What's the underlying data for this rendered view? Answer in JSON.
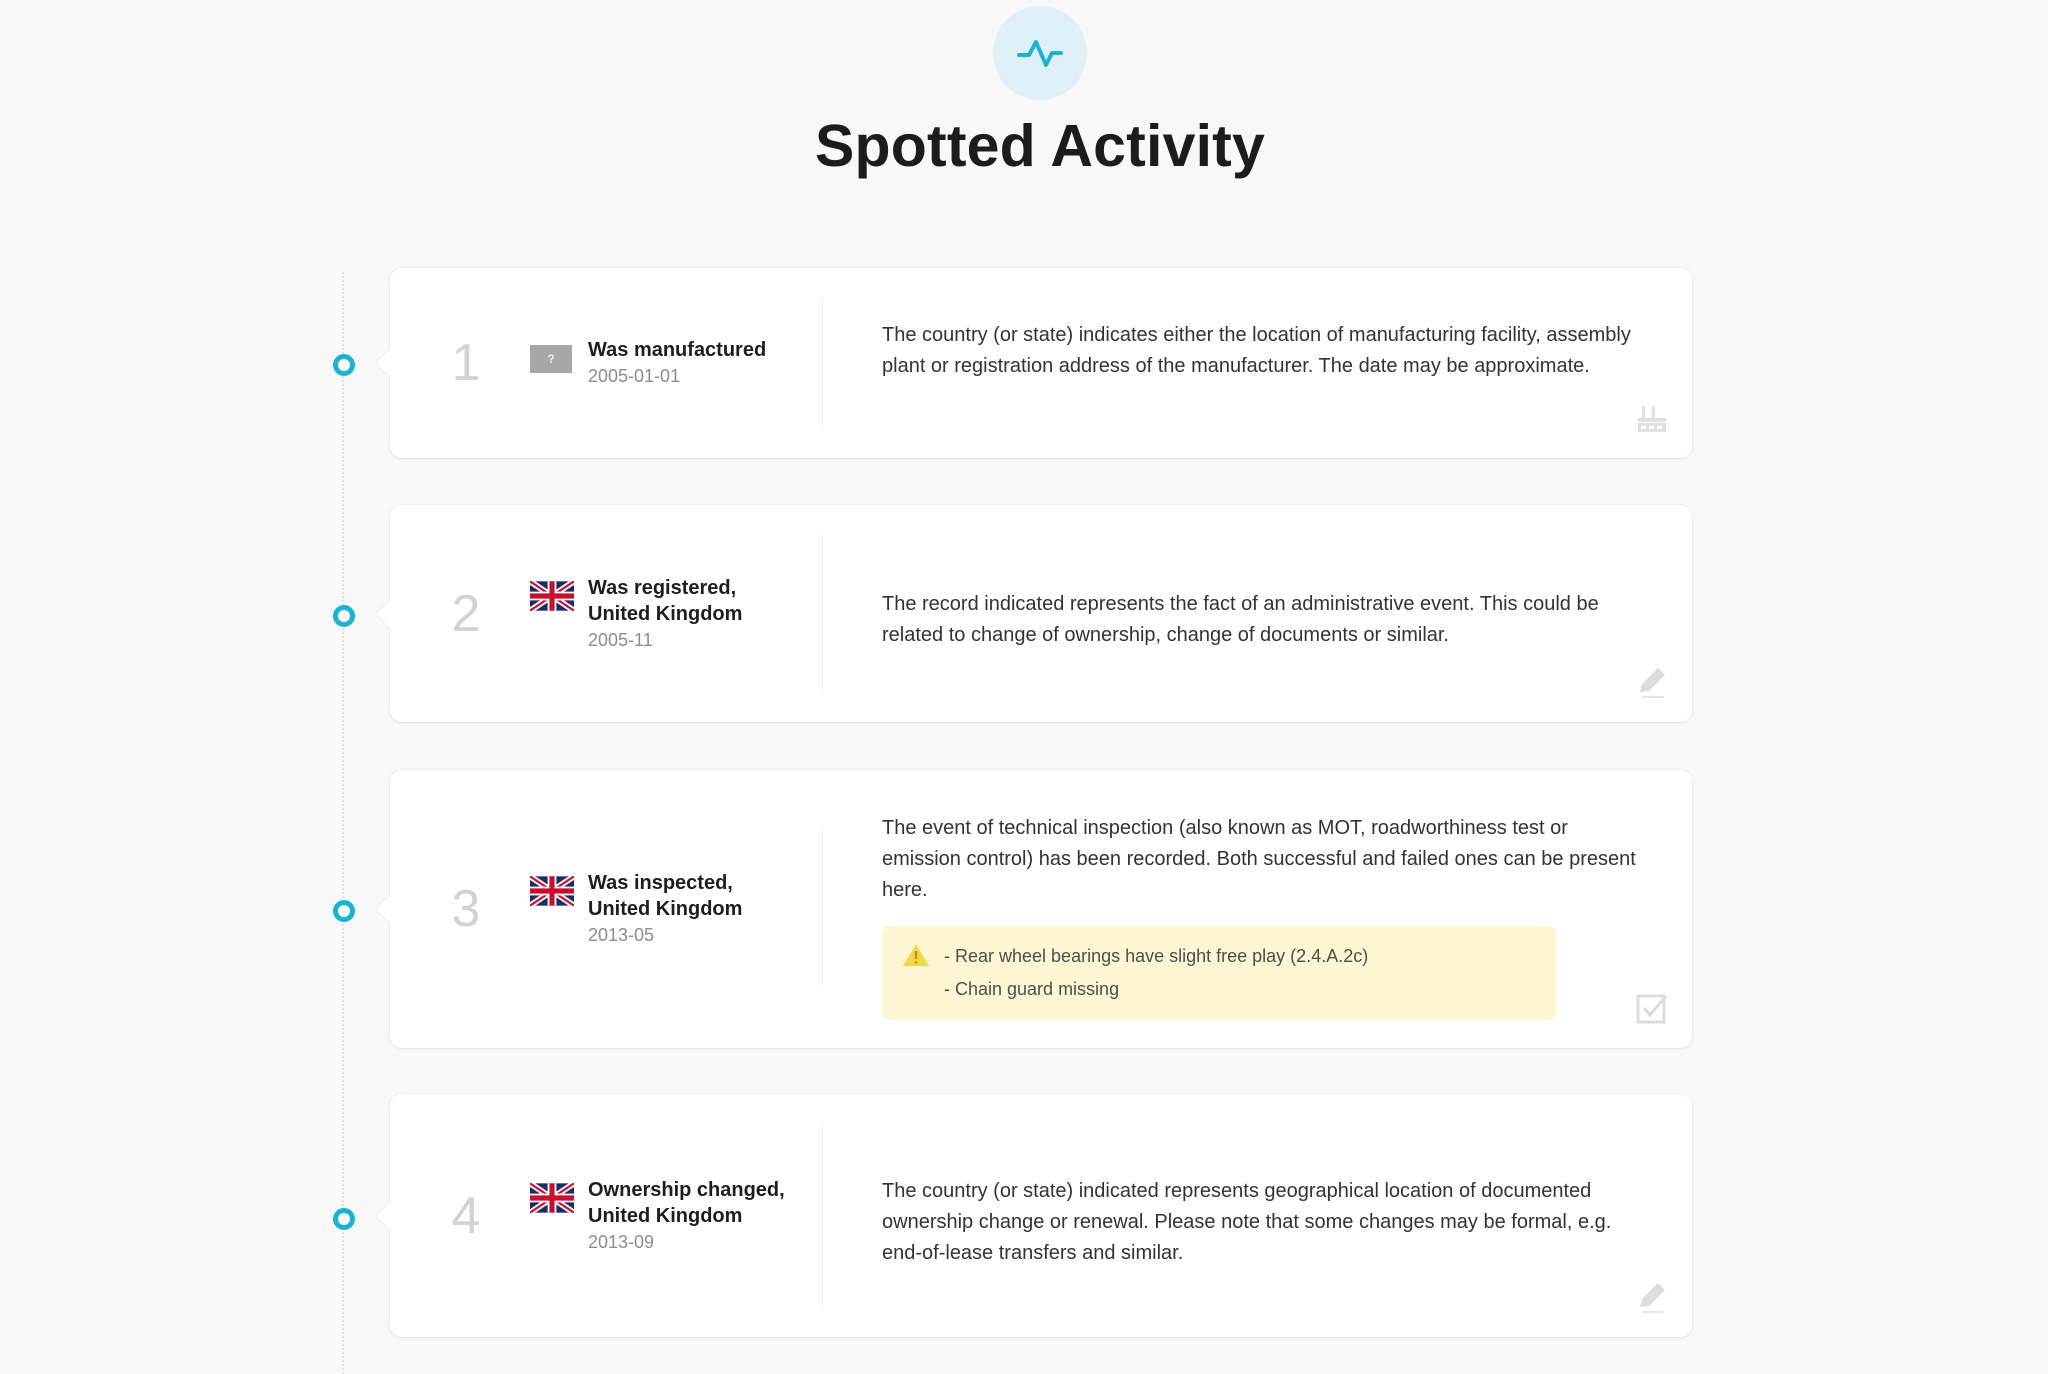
{
  "header": {
    "icon": "activity-pulse-icon",
    "title": "Spotted Activity",
    "accent_color": "#1ab3d4"
  },
  "events": [
    {
      "number": "1",
      "flag": "unknown-flag",
      "flag_text": "?",
      "title": "Was manufactured",
      "date": "2005-01-01",
      "description": "The country (or state) indicates either the location of manufacturing facility, assembly plant or registration address of the manufacturer. The date may be approximate.",
      "icon": "factory-icon"
    },
    {
      "number": "2",
      "flag": "united-kingdom-flag",
      "title": "Was registered, United Kingdom",
      "date": "2005-11",
      "description": "The record indicated represents the fact of an administrative event. This could be related to change of ownership, change of documents or similar.",
      "icon": "pencil-icon"
    },
    {
      "number": "3",
      "flag": "united-kingdom-flag",
      "title": "Was inspected, United Kingdom",
      "date": "2013-05",
      "description": "The event of technical inspection (also known as MOT, roadworthiness test or emission control) has been recorded. Both successful and failed ones can be present here.",
      "warnings": [
        "- Rear wheel bearings have slight free play (2.4.A.2c)",
        "- Chain guard missing"
      ],
      "icon": "checkbox-icon"
    },
    {
      "number": "4",
      "flag": "united-kingdom-flag",
      "title": "Ownership changed, United Kingdom",
      "date": "2013-09",
      "description": "The country (or state) indicated represents geographical location of documented ownership change or renewal. Please note that some changes may be formal, e.g. end-of-lease transfers and similar.",
      "icon": "pencil-icon"
    }
  ]
}
